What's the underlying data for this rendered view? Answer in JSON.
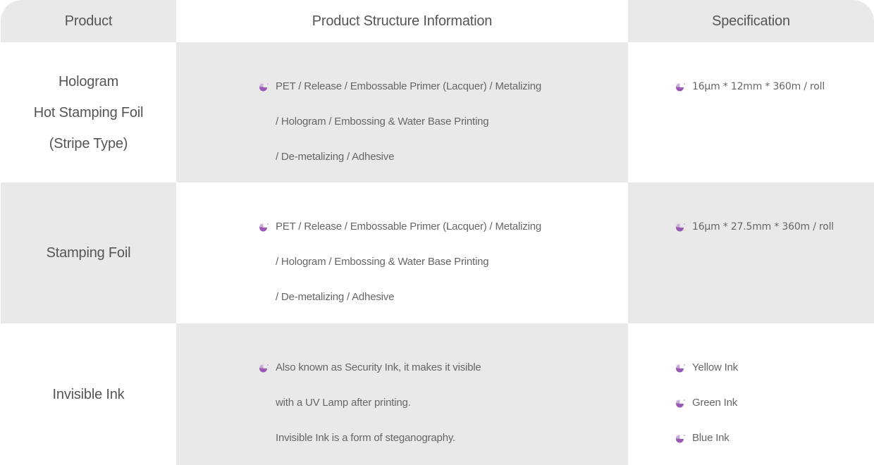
{
  "header": {
    "product": "Product",
    "structure": "Product Structure Information",
    "specification": "Specification"
  },
  "bullet_icon": "pie-bullet-icon",
  "accent_color": "#9b59b6",
  "rows": [
    {
      "product_lines": [
        "Hologram",
        "Hot Stamping Foil",
        "(Stripe Type)"
      ],
      "structure_lines": [
        "PET / Release / Embossable Primer (Lacquer) / Metalizing",
        "/ Hologram / Embossing & Water Base Printing",
        "/ De-metalizing / Adhesive"
      ],
      "specs": [
        "16µm * 12mm * 360m / roll"
      ]
    },
    {
      "product_lines": [
        "Stamping Foil"
      ],
      "structure_lines": [
        "PET / Release / Embossable Primer (Lacquer) / Metalizing",
        "/ Hologram / Embossing & Water Base Printing",
        "/ De-metalizing / Adhesive"
      ],
      "specs": [
        "16µm * 27.5mm * 360m / roll"
      ]
    },
    {
      "product_lines": [
        "Invisible Ink"
      ],
      "structure_lines": [
        "Also known as Security Ink, it makes it visible",
        "with a UV Lamp after printing.",
        "Invisible Ink is a form of steganography."
      ],
      "specs": [
        "Yellow Ink",
        "Green Ink",
        "Blue Ink"
      ]
    }
  ]
}
